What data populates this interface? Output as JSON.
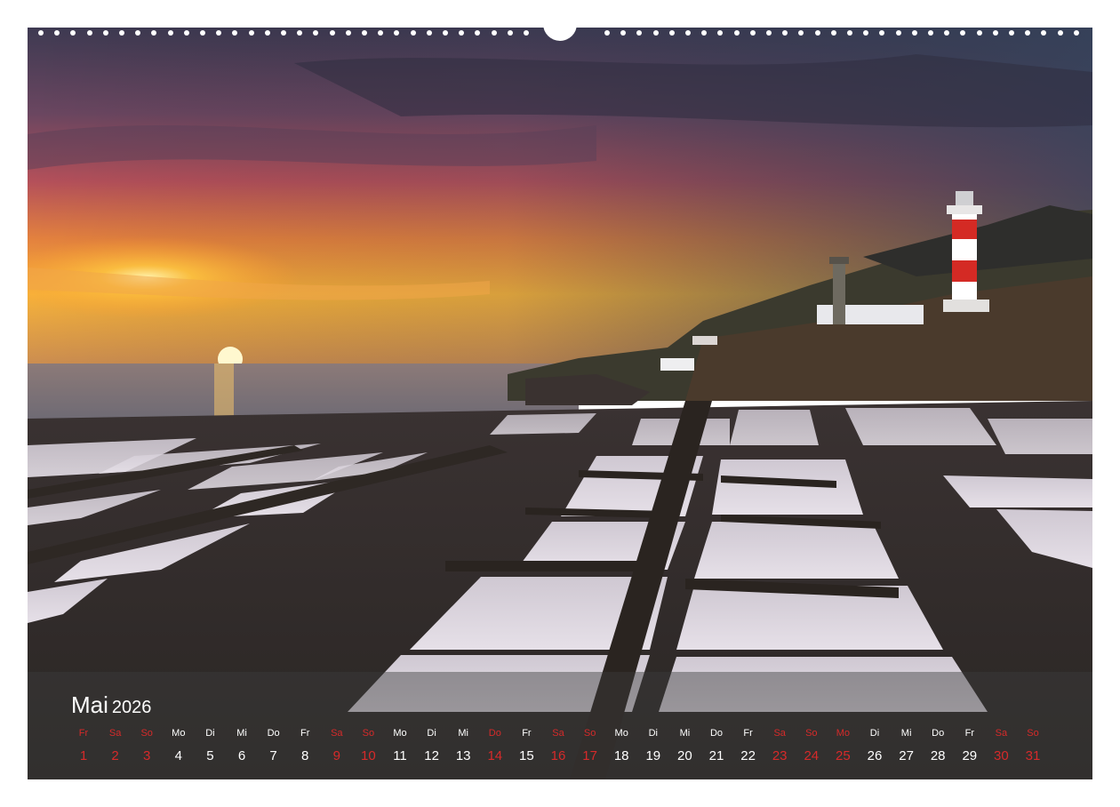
{
  "calendar": {
    "month": "Mai",
    "year": "2026",
    "days": [
      {
        "wd": "Fr",
        "d": "1",
        "red": true
      },
      {
        "wd": "Sa",
        "d": "2",
        "red": true
      },
      {
        "wd": "So",
        "d": "3",
        "red": true
      },
      {
        "wd": "Mo",
        "d": "4",
        "red": false
      },
      {
        "wd": "Di",
        "d": "5",
        "red": false
      },
      {
        "wd": "Mi",
        "d": "6",
        "red": false
      },
      {
        "wd": "Do",
        "d": "7",
        "red": false
      },
      {
        "wd": "Fr",
        "d": "8",
        "red": false
      },
      {
        "wd": "Sa",
        "d": "9",
        "red": true
      },
      {
        "wd": "So",
        "d": "10",
        "red": true
      },
      {
        "wd": "Mo",
        "d": "11",
        "red": false
      },
      {
        "wd": "Di",
        "d": "12",
        "red": false
      },
      {
        "wd": "Mi",
        "d": "13",
        "red": false
      },
      {
        "wd": "Do",
        "d": "14",
        "red": true
      },
      {
        "wd": "Fr",
        "d": "15",
        "red": false
      },
      {
        "wd": "Sa",
        "d": "16",
        "red": true
      },
      {
        "wd": "So",
        "d": "17",
        "red": true
      },
      {
        "wd": "Mo",
        "d": "18",
        "red": false
      },
      {
        "wd": "Di",
        "d": "19",
        "red": false
      },
      {
        "wd": "Mi",
        "d": "20",
        "red": false
      },
      {
        "wd": "Do",
        "d": "21",
        "red": false
      },
      {
        "wd": "Fr",
        "d": "22",
        "red": false
      },
      {
        "wd": "Sa",
        "d": "23",
        "red": true
      },
      {
        "wd": "So",
        "d": "24",
        "red": true
      },
      {
        "wd": "Mo",
        "d": "25",
        "red": true
      },
      {
        "wd": "Di",
        "d": "26",
        "red": false
      },
      {
        "wd": "Mi",
        "d": "27",
        "red": false
      },
      {
        "wd": "Do",
        "d": "28",
        "red": false
      },
      {
        "wd": "Fr",
        "d": "29",
        "red": false
      },
      {
        "wd": "Sa",
        "d": "30",
        "red": true
      },
      {
        "wd": "So",
        "d": "31",
        "red": true
      }
    ]
  },
  "colors": {
    "weekend": "#d62a2a",
    "weekday": "#ffffff",
    "sun": "#ffd24a"
  }
}
